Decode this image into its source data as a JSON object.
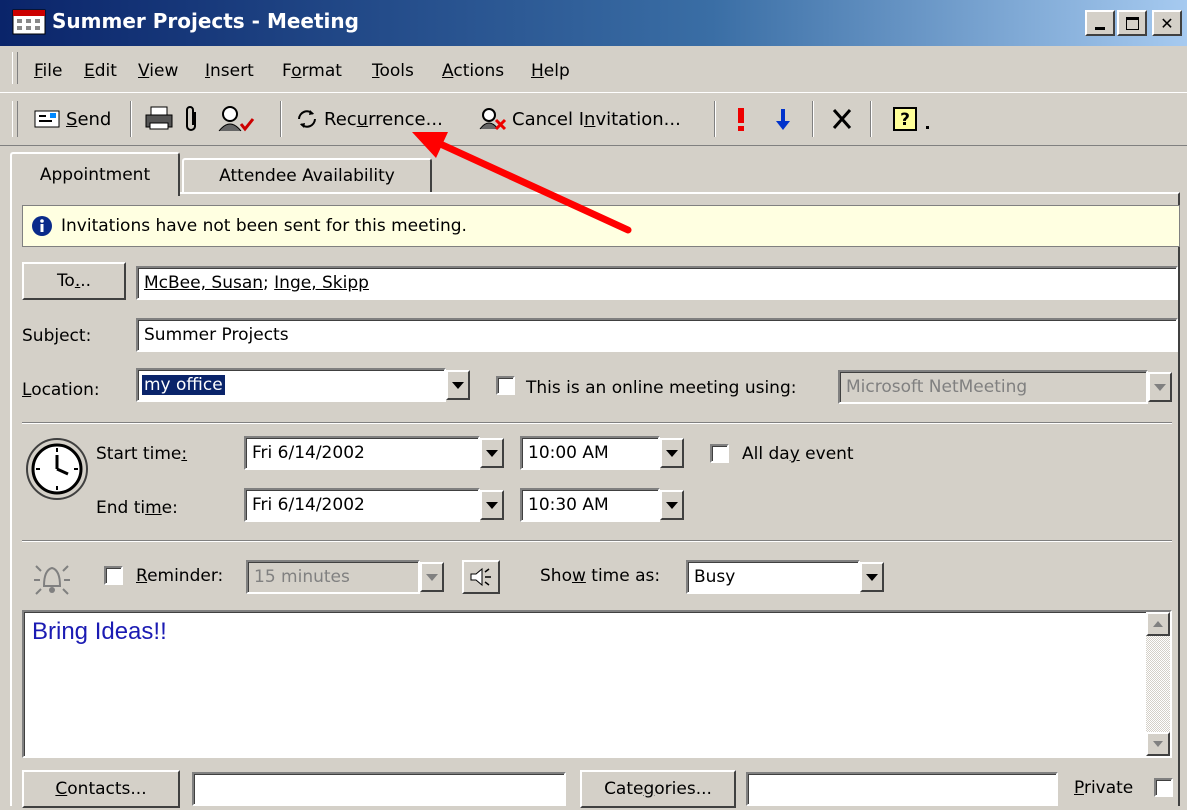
{
  "window": {
    "title": "Summer Projects - Meeting"
  },
  "menu": [
    "File",
    "Edit",
    "View",
    "Insert",
    "Format",
    "Tools",
    "Actions",
    "Help"
  ],
  "toolbar": {
    "send": "Send",
    "recurrence": "Recurrence...",
    "cancel_invitation": "Cancel Invitation..."
  },
  "tabs": [
    "Appointment",
    "Attendee Availability"
  ],
  "info_message": "Invitations have not been sent for this meeting.",
  "form": {
    "to_button": "To...",
    "to_recipients": [
      "McBee, Susan",
      "Inge, Skipp"
    ],
    "to_separator": "; ",
    "subject_label": "Subject:",
    "subject_value": "Summer Projects",
    "location_label": "Location:",
    "location_value": "my office",
    "online_label": "This is an online meeting using:",
    "online_value": "Microsoft NetMeeting",
    "start_label": "Start time:",
    "start_date": "Fri 6/14/2002",
    "start_time": "10:00 AM",
    "all_day_label": "All day event",
    "end_label": "End time:",
    "end_date": "Fri 6/14/2002",
    "end_time": "10:30 AM",
    "reminder_label": "Reminder:",
    "reminder_value": "15 minutes",
    "show_time_label": "Show time as:",
    "show_time_value": "Busy",
    "notes": "Bring Ideas!!",
    "contacts_button": "Contacts...",
    "contacts_value": "",
    "categories_button": "Categories...",
    "categories_value": "",
    "private_label": "Private"
  },
  "colors": {
    "title_start": "#0a246a",
    "title_end": "#a6caf0",
    "info_bg": "#ffffe1",
    "notes_text": "#1b1bb3",
    "annotation_arrow": "#ff0000"
  }
}
